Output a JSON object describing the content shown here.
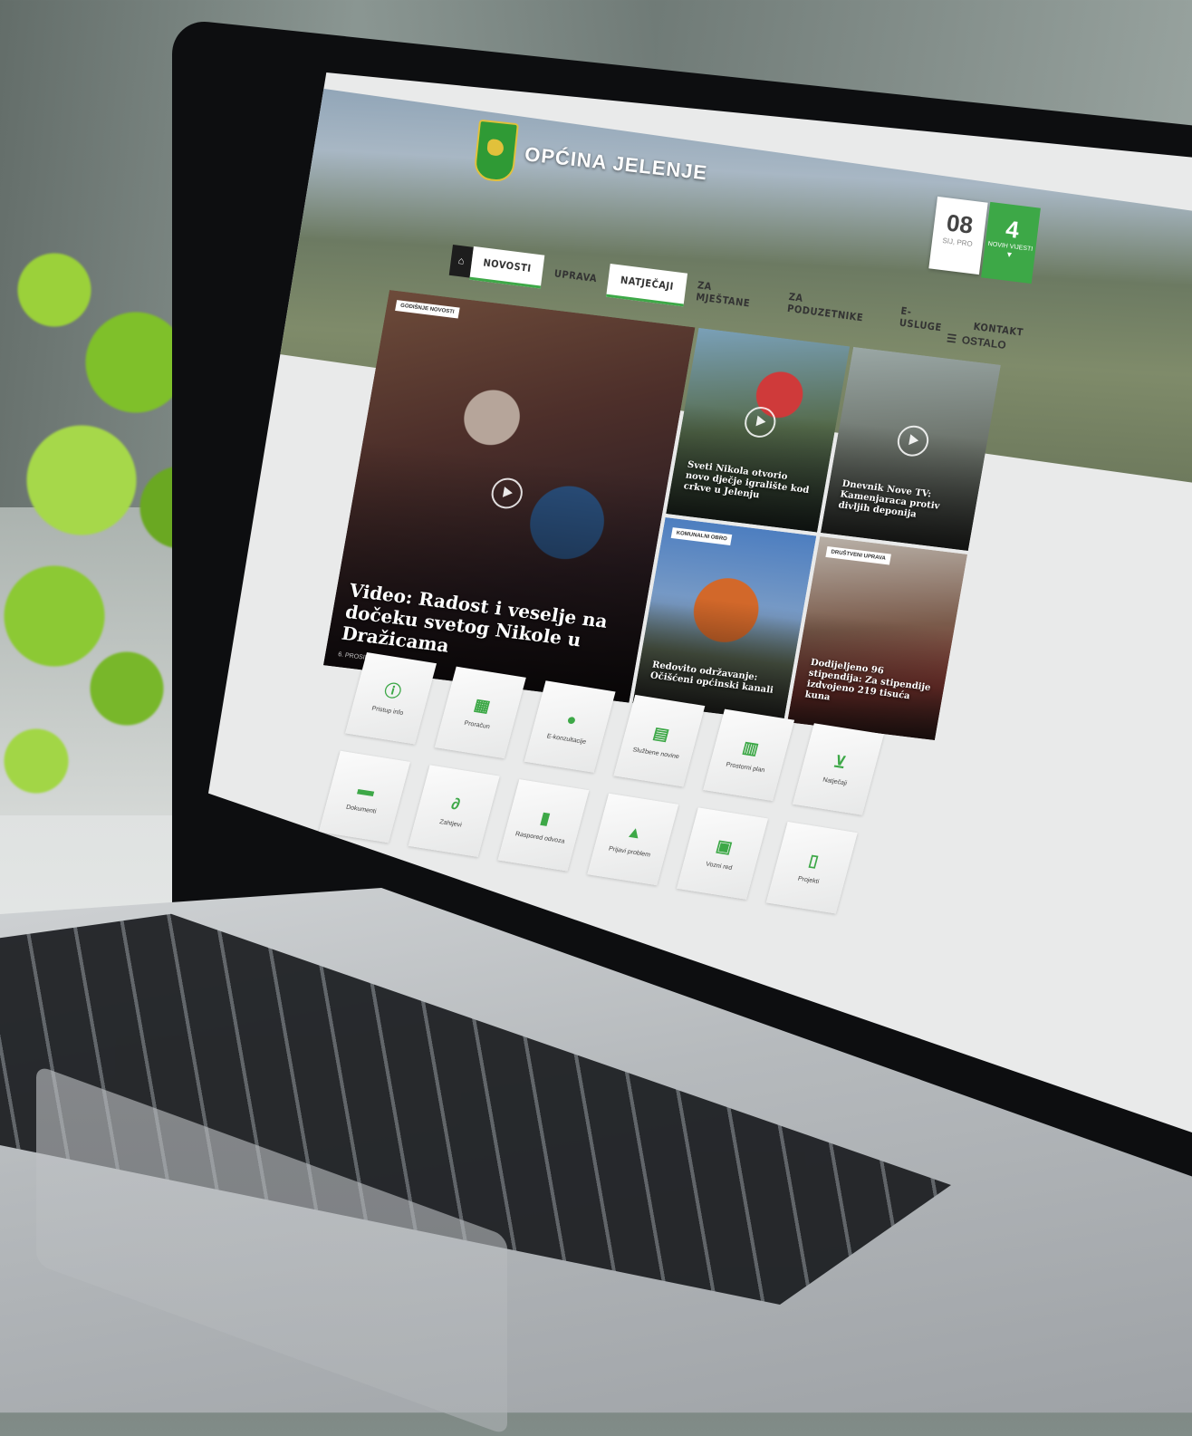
{
  "site": {
    "name": "OPĆINA JELENJE"
  },
  "date": {
    "day": "08",
    "month": "SIJ, PRO"
  },
  "news_badge": {
    "count": "4",
    "label": "NOVIH VIJESTI",
    "chevron": "▾"
  },
  "nav": {
    "home_icon": "home-icon",
    "items": [
      "NOVOSTI",
      "UPRAVA",
      "NATJEČAJI",
      "ZA MJEŠTANE",
      "ZA PODUZETNIKE",
      "E-USLUGE",
      "KONTAKT"
    ],
    "other": "OSTALO"
  },
  "features": [
    {
      "tag": "GODIŠNJE NOVOSTI",
      "title": "Video: Radost i veselje na dočeku svetog Nikole u Dražicama",
      "date": "6. PROSINAC 2016"
    },
    {
      "tag": "",
      "title": "Sveti Nikola otvorio novo dječje igralište kod crkve u Jelenju",
      "date": ""
    },
    {
      "tag": "",
      "title": "Dnevnik Nove TV: Kamenjaraca protiv divljih deponija",
      "date": ""
    },
    {
      "tag": "KOMUNALNI OBRO",
      "title": "Redovito održavanje: Očišćeni općinski kanali",
      "date": ""
    },
    {
      "tag": "DRUŠTVENI UPRAVA",
      "title": "Dodijeljeno 96 stipendija: Za stipendije izdvojeno 219 tisuća kuna",
      "date": ""
    }
  ],
  "services": [
    {
      "label": "Pristup info",
      "icon": "info-icon"
    },
    {
      "label": "Proračun",
      "icon": "calculator-icon"
    },
    {
      "label": "E-konzultacije",
      "icon": "chat-icon"
    },
    {
      "label": "Službene novine",
      "icon": "document-icon"
    },
    {
      "label": "Prostorni plan",
      "icon": "map-icon"
    },
    {
      "label": "Natječaji",
      "icon": "cart-icon"
    },
    {
      "label": "Dokumenti",
      "icon": "folder-icon"
    },
    {
      "label": "Zahtjevi",
      "icon": "paperclip-icon"
    },
    {
      "label": "Raspored odvoza",
      "icon": "trash-icon"
    },
    {
      "label": "Prijavi problem",
      "icon": "warning-icon"
    },
    {
      "label": "Vozni red",
      "icon": "bus-icon"
    },
    {
      "label": "Projekti",
      "icon": "building-icon"
    }
  ],
  "colors": {
    "accent": "#3da847",
    "header_dark": "#1d1d1d"
  }
}
